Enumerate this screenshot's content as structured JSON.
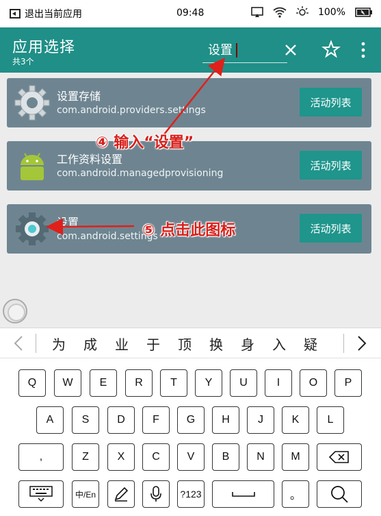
{
  "status_bar": {
    "back_label": "退出当前应用",
    "time": "09:48",
    "battery": "100%"
  },
  "header": {
    "title": "应用选择",
    "subtitle": "共3个",
    "search_value": "设置",
    "accent_color": "#1f8f87"
  },
  "apps": [
    {
      "name": "设置存储",
      "package": "com.android.providers.settings",
      "button": "活动列表",
      "icon": "gear-icon"
    },
    {
      "name": "工作资料设置",
      "package": "com.android.managedprovisioning",
      "button": "活动列表",
      "icon": "android-robot-icon"
    },
    {
      "name": "设置",
      "package": "com.android.settings",
      "button": "活动列表",
      "icon": "settings-icon"
    }
  ],
  "annotations": {
    "step4": "④ 输入“设置”",
    "step5": "⑤ 点击此图标"
  },
  "keyboard": {
    "candidates": [
      "为",
      "成",
      "业",
      "于",
      "顶",
      "换",
      "身",
      "入",
      "疑"
    ],
    "row1": [
      "Q",
      "W",
      "E",
      "R",
      "T",
      "Y",
      "U",
      "I",
      "O",
      "P"
    ],
    "row2": [
      "A",
      "S",
      "D",
      "F",
      "G",
      "H",
      "J",
      "K",
      "L"
    ],
    "row3": [
      ",",
      "Z",
      "X",
      "C",
      "V",
      "B",
      "N",
      "M"
    ],
    "symbols_label": "?123",
    "period_label": "。",
    "lang_label": "中/En"
  }
}
